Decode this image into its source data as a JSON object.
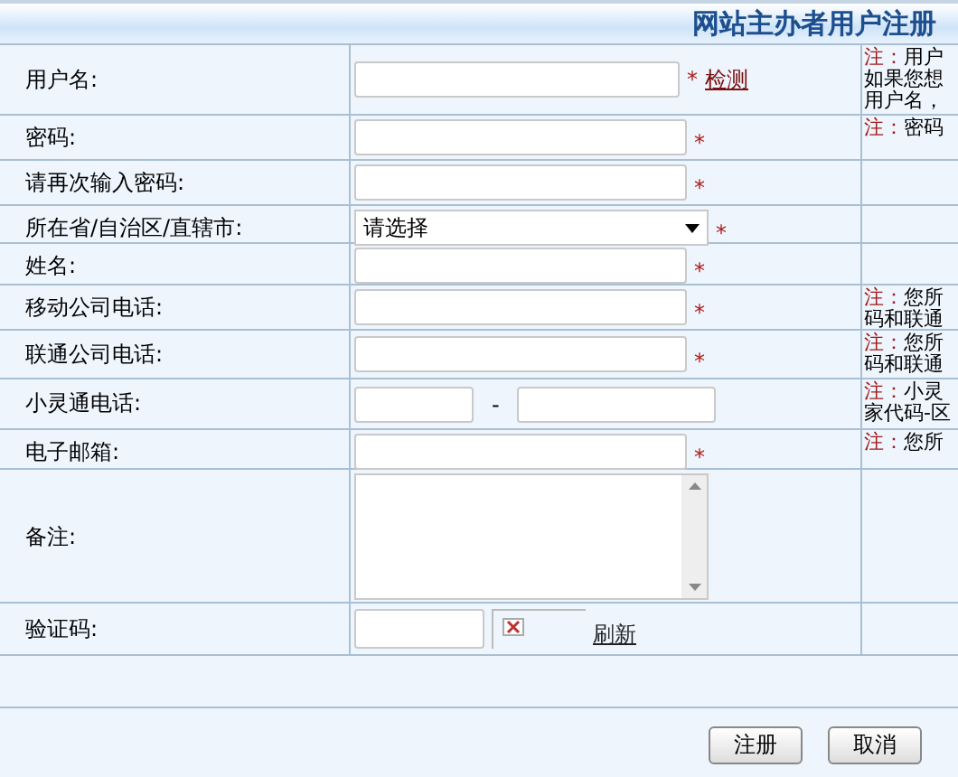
{
  "title": "网站主办者用户注册",
  "rows": [
    {
      "kind": "text",
      "label": "用户名:",
      "required": true,
      "link": "检测",
      "note": {
        "label": "注：",
        "lines": [
          "用户",
          "如果您想",
          "用户名，"
        ]
      }
    },
    {
      "kind": "text",
      "label": "密码:",
      "required": true,
      "note": {
        "label": "注：",
        "lines": [
          "密码"
        ]
      }
    },
    {
      "kind": "text",
      "label": "请再次输入密码:",
      "required": true
    },
    {
      "kind": "select",
      "label": "所在省/自治区/直辖市:",
      "value": "请选择",
      "required": true
    },
    {
      "kind": "text",
      "label": "姓名:",
      "required": true
    },
    {
      "kind": "text",
      "label": "移动公司电话:",
      "required": true,
      "note": {
        "label": "注：",
        "lines": [
          "您所",
          "码和联通"
        ]
      }
    },
    {
      "kind": "text",
      "label": "联通公司电话:",
      "required": true,
      "note": {
        "label": "注：",
        "lines": [
          "您所",
          "码和联通"
        ]
      }
    },
    {
      "kind": "phone",
      "label": "小灵通电话:",
      "separator": "-",
      "required": false,
      "note": {
        "label": "注：",
        "lines": [
          "小灵",
          "家代码-区"
        ]
      }
    },
    {
      "kind": "text",
      "label": "电子邮箱:",
      "required": true,
      "note": {
        "label": "注：",
        "lines": [
          "您所"
        ]
      }
    },
    {
      "kind": "textarea",
      "label": "备注:",
      "required": false
    },
    {
      "kind": "captcha",
      "label": "验证码:",
      "link": "刷新",
      "required": false
    }
  ],
  "required_mark": "*",
  "buttons": [
    "注册",
    "取消"
  ]
}
